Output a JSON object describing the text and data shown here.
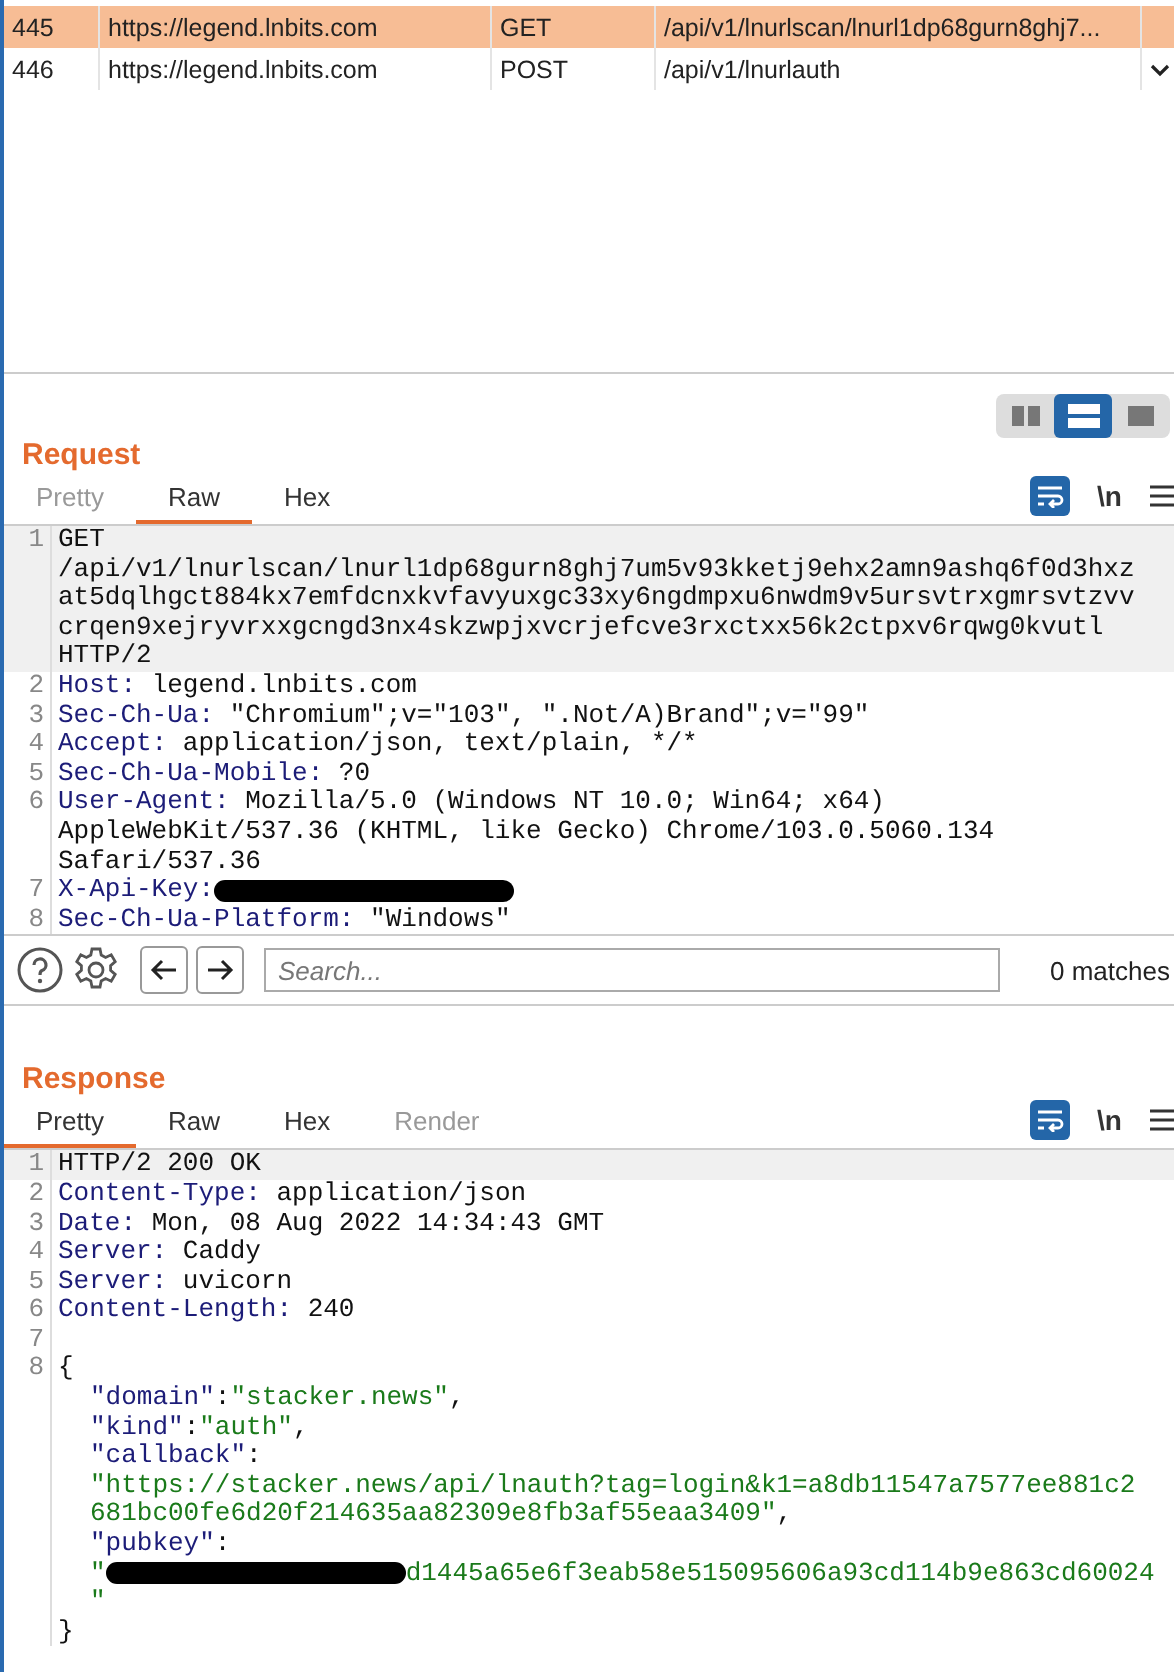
{
  "history": {
    "rows": [
      {
        "number": "445",
        "host": "https://legend.lnbits.com",
        "method": "GET",
        "path": "/api/v1/lnurlscan/lnurl1dp68gurn8ghj7...",
        "selected": true
      },
      {
        "number": "446",
        "host": "https://legend.lnbits.com",
        "method": "POST",
        "path": "/api/v1/lnurlauth",
        "selected": false
      }
    ]
  },
  "layout_buttons": [
    {
      "kind": "side-by-side",
      "selected": false
    },
    {
      "kind": "stacked",
      "selected": true
    },
    {
      "kind": "single",
      "selected": false
    }
  ],
  "request": {
    "title": "Request",
    "tabs": [
      {
        "label": "Pretty",
        "selected": false,
        "disabled": true
      },
      {
        "label": "Raw",
        "selected": true,
        "disabled": false
      },
      {
        "label": "Hex",
        "selected": false,
        "disabled": false
      }
    ],
    "newline_toggle": "\\n",
    "lines": [
      {
        "number": "1",
        "highlighted": true,
        "rows": [
          {
            "indented": false,
            "segments": [
              {
                "kind": "plain",
                "text": "GET"
              }
            ]
          },
          {
            "indented": false,
            "segments": [
              {
                "kind": "plain",
                "text": "/api/v1/lnurlscan/lnurl1dp68gurn8ghj7um5v93kketj9ehx2amn9ashq6f0d3hxz"
              }
            ]
          },
          {
            "indented": false,
            "segments": [
              {
                "kind": "plain",
                "text": "at5dqlhgct884kx7emfdcnxkvfavyuxgc33xy6ngdmpxu6nwdm9v5ursvtrxgmrsvtzvv"
              }
            ]
          },
          {
            "indented": false,
            "segments": [
              {
                "kind": "plain",
                "text": "crqen9xejryvrxxgcngd3nx4skzwpjxvcrjefcve3rxctxx56k2ctpxv6rqwg0kvutl"
              }
            ]
          },
          {
            "indented": false,
            "segments": [
              {
                "kind": "plain",
                "text": "HTTP/2"
              }
            ]
          }
        ]
      },
      {
        "number": "2",
        "highlighted": false,
        "rows": [
          {
            "indented": false,
            "segments": [
              {
                "kind": "name",
                "text": "Host:"
              },
              {
                "kind": "plain",
                "text": " legend.lnbits.com"
              }
            ]
          }
        ]
      },
      {
        "number": "3",
        "highlighted": false,
        "rows": [
          {
            "indented": false,
            "segments": [
              {
                "kind": "name",
                "text": "Sec-Ch-Ua:"
              },
              {
                "kind": "plain",
                "text": " \"Chromium\";v=\"103\", \".Not/A)Brand\";v=\"99\""
              }
            ]
          }
        ]
      },
      {
        "number": "4",
        "highlighted": false,
        "rows": [
          {
            "indented": false,
            "segments": [
              {
                "kind": "name",
                "text": "Accept:"
              },
              {
                "kind": "plain",
                "text": " application/json, text/plain, */*"
              }
            ]
          }
        ]
      },
      {
        "number": "5",
        "highlighted": false,
        "rows": [
          {
            "indented": false,
            "segments": [
              {
                "kind": "name",
                "text": "Sec-Ch-Ua-Mobile:"
              },
              {
                "kind": "plain",
                "text": " ?0"
              }
            ]
          }
        ]
      },
      {
        "number": "6",
        "highlighted": false,
        "rows": [
          {
            "indented": false,
            "segments": [
              {
                "kind": "name",
                "text": "User-Agent:"
              },
              {
                "kind": "plain",
                "text": " Mozilla/5.0 (Windows NT 10.0; Win64; x64)"
              }
            ]
          },
          {
            "indented": false,
            "segments": [
              {
                "kind": "plain",
                "text": "AppleWebKit/537.36 (KHTML, like Gecko) Chrome/103.0.5060.134"
              }
            ]
          },
          {
            "indented": false,
            "segments": [
              {
                "kind": "plain",
                "text": "Safari/537.36"
              }
            ]
          }
        ]
      },
      {
        "number": "7",
        "highlighted": false,
        "rows": [
          {
            "indented": false,
            "segments": [
              {
                "kind": "name",
                "text": "X-Api-Key:"
              },
              {
                "kind": "redacted"
              }
            ]
          }
        ]
      },
      {
        "number": "8",
        "highlighted": false,
        "rows": [
          {
            "indented": false,
            "segments": [
              {
                "kind": "name",
                "text": "Sec-Ch-Ua-Platform:"
              },
              {
                "kind": "plain",
                "text": " \"Windows\""
              }
            ]
          }
        ]
      }
    ]
  },
  "search": {
    "placeholder": "Search...",
    "matches": "0 matches"
  },
  "response": {
    "title": "Response",
    "tabs": [
      {
        "label": "Pretty",
        "selected": true,
        "disabled": false
      },
      {
        "label": "Raw",
        "selected": false,
        "disabled": false
      },
      {
        "label": "Hex",
        "selected": false,
        "disabled": false
      },
      {
        "label": "Render",
        "selected": false,
        "disabled": true
      }
    ],
    "newline_toggle": "\\n",
    "lines": [
      {
        "number": "1",
        "highlighted": true,
        "rows": [
          {
            "indented": false,
            "segments": [
              {
                "kind": "plain",
                "text": "HTTP/2 200 OK"
              }
            ]
          }
        ]
      },
      {
        "number": "2",
        "highlighted": false,
        "rows": [
          {
            "indented": false,
            "segments": [
              {
                "kind": "name",
                "text": "Content-Type:"
              },
              {
                "kind": "plain",
                "text": " application/json"
              }
            ]
          }
        ]
      },
      {
        "number": "3",
        "highlighted": false,
        "rows": [
          {
            "indented": false,
            "segments": [
              {
                "kind": "name",
                "text": "Date:"
              },
              {
                "kind": "plain",
                "text": " Mon, 08 Aug 2022 14:34:43 GMT"
              }
            ]
          }
        ]
      },
      {
        "number": "4",
        "highlighted": false,
        "rows": [
          {
            "indented": false,
            "segments": [
              {
                "kind": "name",
                "text": "Server:"
              },
              {
                "kind": "plain",
                "text": " Caddy"
              }
            ]
          }
        ]
      },
      {
        "number": "5",
        "highlighted": false,
        "rows": [
          {
            "indented": false,
            "segments": [
              {
                "kind": "name",
                "text": "Server:"
              },
              {
                "kind": "plain",
                "text": " uvicorn"
              }
            ]
          }
        ]
      },
      {
        "number": "6",
        "highlighted": false,
        "rows": [
          {
            "indented": false,
            "segments": [
              {
                "kind": "name",
                "text": "Content-Length:"
              },
              {
                "kind": "plain",
                "text": " 240"
              }
            ]
          }
        ]
      },
      {
        "number": "7",
        "highlighted": false
      },
      {
        "number": "8",
        "highlighted": false,
        "rows": [
          {
            "indented": false,
            "segments": [
              {
                "kind": "plain",
                "text": "{"
              }
            ]
          },
          {
            "indented": true,
            "segments": [
              {
                "kind": "name",
                "text": "\"domain\""
              },
              {
                "kind": "plain",
                "text": ":"
              },
              {
                "kind": "string",
                "text": "\"stacker.news\""
              },
              {
                "kind": "plain",
                "text": ","
              }
            ]
          },
          {
            "indented": true,
            "segments": [
              {
                "kind": "name",
                "text": "\"kind\""
              },
              {
                "kind": "plain",
                "text": ":"
              },
              {
                "kind": "string",
                "text": "\"auth\""
              },
              {
                "kind": "plain",
                "text": ","
              }
            ]
          },
          {
            "indented": true,
            "segments": [
              {
                "kind": "name",
                "text": "\"callback\""
              },
              {
                "kind": "plain",
                "text": ":"
              }
            ]
          },
          {
            "indented": true,
            "segments": [
              {
                "kind": "string",
                "text": "\"https://stacker.news/api/lnauth?tag=login&k1=a8db11547a7577ee881c2"
              }
            ]
          },
          {
            "indented": true,
            "segments": [
              {
                "kind": "string",
                "text": "681bc00fe6d20f214635aa82309e8fb3af55eaa3409\""
              },
              {
                "kind": "plain",
                "text": ","
              }
            ]
          },
          {
            "indented": true,
            "segments": [
              {
                "kind": "name",
                "text": "\"pubkey\""
              },
              {
                "kind": "plain",
                "text": ":"
              }
            ]
          },
          {
            "indented": true,
            "segments": [
              {
                "kind": "string",
                "text": "\""
              },
              {
                "kind": "redacted"
              },
              {
                "kind": "string",
                "text": "d1445a65e6f3eab58e515095606a93cd114b9e863cd60024"
              }
            ]
          },
          {
            "indented": true,
            "segments": [
              {
                "kind": "string",
                "text": "\""
              }
            ]
          },
          {
            "indented": false,
            "segments": [
              {
                "kind": "plain",
                "text": "}"
              }
            ]
          }
        ]
      }
    ]
  }
}
